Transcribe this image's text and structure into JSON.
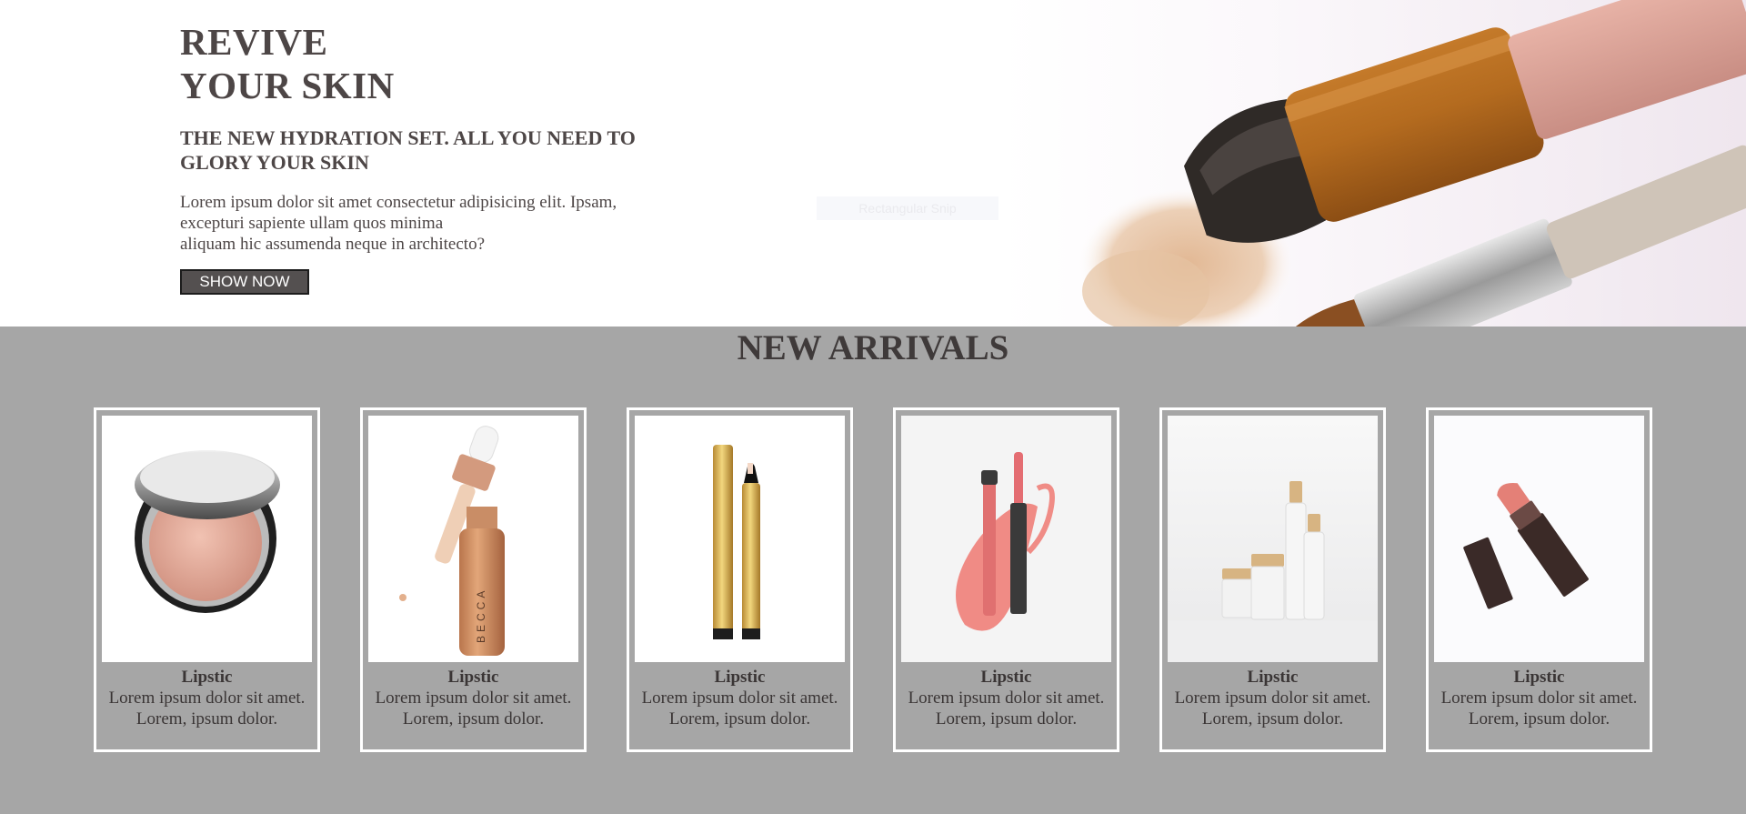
{
  "hero": {
    "title_line1": "REVIVE",
    "title_line2": "YOUR SKIN",
    "subtitle": "THE NEW HYDRATION SET. ALL YOU NEED TO GLORY YOUR SKIN",
    "description_line1": "Lorem ipsum dolor sit amet consectetur adipisicing elit. Ipsam, excepturi sapiente ullam quos minima",
    "description_line2": "aliquam hic assumenda neque in architecto?",
    "button_label": "SHOW NOW",
    "overlay_label": "Rectangular Snip"
  },
  "arrivals": {
    "heading": "NEW ARRIVALS",
    "products": [
      {
        "name": "Lipstic",
        "desc_line1": "Lorem ipsum dolor sit amet.",
        "desc_line2": "Lorem, ipsum dolor.",
        "image": "compact-blush-image"
      },
      {
        "name": "Lipstic",
        "desc_line1": "Lorem ipsum dolor sit amet.",
        "desc_line2": "Lorem, ipsum dolor.",
        "image": "highlighter-dropper-bottle-image",
        "brand_text": "BECCA"
      },
      {
        "name": "Lipstic",
        "desc_line1": "Lorem ipsum dolor sit amet.",
        "desc_line2": "Lorem, ipsum dolor.",
        "image": "concealer-pens-image"
      },
      {
        "name": "Lipstic",
        "desc_line1": "Lorem ipsum dolor sit amet.",
        "desc_line2": "Lorem, ipsum dolor.",
        "image": "lip-gloss-swatch-image"
      },
      {
        "name": "Lipstic",
        "desc_line1": "Lorem ipsum dolor sit amet.",
        "desc_line2": "Lorem, ipsum dolor.",
        "image": "skincare-jars-image"
      },
      {
        "name": "Lipstic",
        "desc_line1": "Lorem ipsum dolor sit amet.",
        "desc_line2": "Lorem, ipsum dolor.",
        "image": "lipstick-image"
      }
    ]
  },
  "colors": {
    "page_background": "#a6a6a6",
    "hero_background": "#ffffff",
    "text": "#4d4646",
    "button_fill": "#545050",
    "card_border": "#ffffff"
  }
}
